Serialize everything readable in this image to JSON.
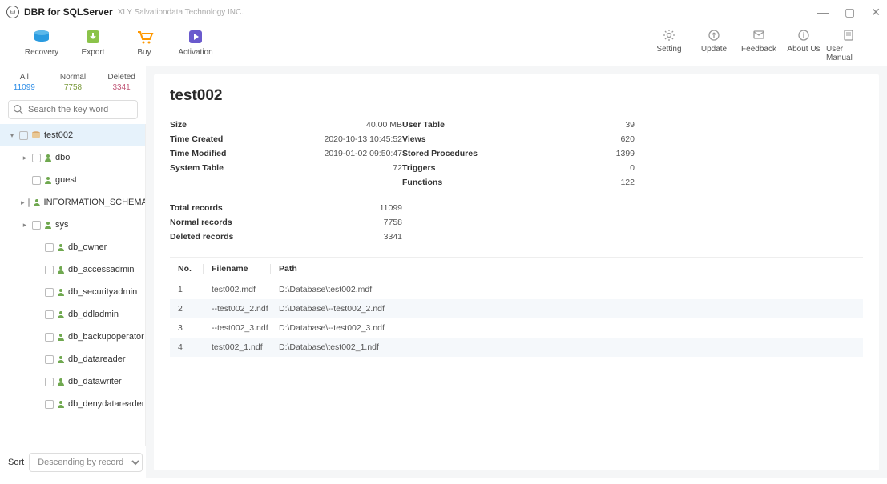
{
  "titlebar": {
    "app_name": "DBR for SQLServer",
    "vendor": "XLY Salvationdata Technology INC."
  },
  "toolbar": {
    "left": [
      {
        "label": "Recovery",
        "icon": "recovery"
      },
      {
        "label": "Export",
        "icon": "export"
      },
      {
        "label": "Buy",
        "icon": "buy"
      },
      {
        "label": "Activation",
        "icon": "activation"
      }
    ],
    "right": [
      {
        "label": "Setting",
        "icon": "gear"
      },
      {
        "label": "Update",
        "icon": "update"
      },
      {
        "label": "Feedback",
        "icon": "feedback"
      },
      {
        "label": "About Us",
        "icon": "info"
      },
      {
        "label": "User Manual",
        "icon": "manual"
      }
    ]
  },
  "filters": {
    "all": {
      "label": "All",
      "count": "11099"
    },
    "normal": {
      "label": "Normal",
      "count": "7758"
    },
    "deleted": {
      "label": "Deleted",
      "count": "3341"
    }
  },
  "search": {
    "placeholder": "Search the key word"
  },
  "tree": [
    {
      "label": "test002",
      "icon": "db",
      "indent": 0,
      "exp": "−",
      "sel": true
    },
    {
      "label": "dbo",
      "icon": "user",
      "indent": 1,
      "exp": "+"
    },
    {
      "label": "guest",
      "icon": "user",
      "indent": 1,
      "exp": ""
    },
    {
      "label": "INFORMATION_SCHEMA",
      "icon": "user",
      "indent": 1,
      "exp": "+"
    },
    {
      "label": "sys",
      "icon": "user",
      "indent": 1,
      "exp": "+"
    },
    {
      "label": "db_owner",
      "icon": "user",
      "indent": 2,
      "exp": ""
    },
    {
      "label": "db_accessadmin",
      "icon": "user",
      "indent": 2,
      "exp": ""
    },
    {
      "label": "db_securityadmin",
      "icon": "user",
      "indent": 2,
      "exp": ""
    },
    {
      "label": "db_ddladmin",
      "icon": "user",
      "indent": 2,
      "exp": ""
    },
    {
      "label": "db_backupoperator",
      "icon": "user",
      "indent": 2,
      "exp": ""
    },
    {
      "label": "db_datareader",
      "icon": "user",
      "indent": 2,
      "exp": ""
    },
    {
      "label": "db_datawriter",
      "icon": "user",
      "indent": 2,
      "exp": ""
    },
    {
      "label": "db_denydatareader",
      "icon": "user",
      "indent": 2,
      "exp": ""
    }
  ],
  "sort": {
    "label": "Sort",
    "value": "Descending by record"
  },
  "detail": {
    "title": "test002",
    "left": [
      {
        "k": "Size",
        "v": "40.00 MB"
      },
      {
        "k": "Time Created",
        "v": "2020-10-13 10:45:52"
      },
      {
        "k": "Time Modified",
        "v": "2019-01-02 09:50:47"
      },
      {
        "k": "System Table",
        "v": "72"
      }
    ],
    "right": [
      {
        "k": "User Table",
        "v": "39"
      },
      {
        "k": "Views",
        "v": "620"
      },
      {
        "k": "Stored Procedures",
        "v": "1399"
      },
      {
        "k": "Triggers",
        "v": "0"
      },
      {
        "k": "Functions",
        "v": "122"
      }
    ],
    "records": [
      {
        "k": "Total records",
        "v": "11099",
        "cls": "v-all"
      },
      {
        "k": "Normal records",
        "v": "7758",
        "cls": "v-normal"
      },
      {
        "k": "Deleted records",
        "v": "3341",
        "cls": "v-deleted"
      }
    ],
    "files_header": {
      "no": "No.",
      "filename": "Filename",
      "path": "Path"
    },
    "files": [
      {
        "no": "1",
        "filename": "test002.mdf",
        "path": "D:\\Database\\test002.mdf"
      },
      {
        "no": "2",
        "filename": "--test002_2.ndf",
        "path": "D:\\Database\\--test002_2.ndf"
      },
      {
        "no": "3",
        "filename": "--test002_3.ndf",
        "path": "D:\\Database\\--test002_3.ndf"
      },
      {
        "no": "4",
        "filename": "test002_1.ndf",
        "path": "D:\\Database\\test002_1.ndf"
      }
    ]
  }
}
